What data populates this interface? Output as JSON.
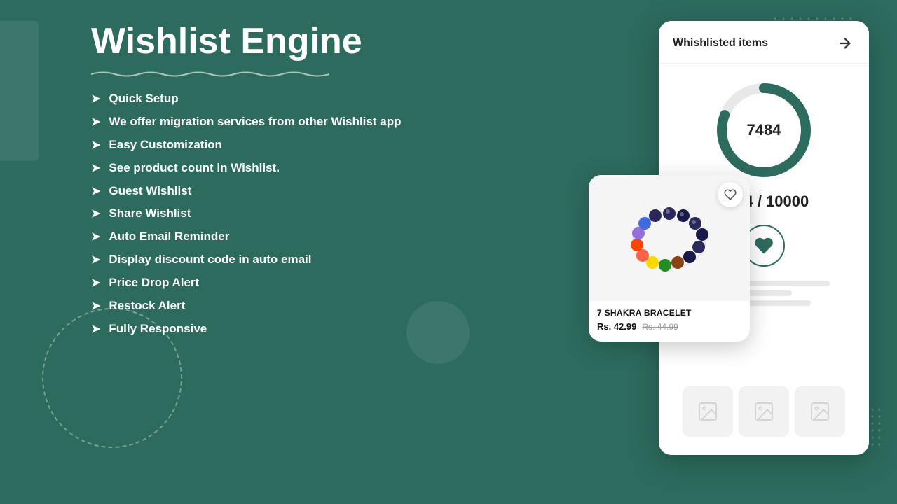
{
  "page": {
    "bg_color": "#2d6b5e"
  },
  "header": {
    "title": "Wishlist Engine"
  },
  "features": {
    "items": [
      {
        "id": "quick-setup",
        "text": "Quick Setup"
      },
      {
        "id": "migration",
        "text": "We offer migration services from other Wishlist app"
      },
      {
        "id": "customization",
        "text": "Easy Customization"
      },
      {
        "id": "product-count",
        "text": "See product count in Wishlist."
      },
      {
        "id": "guest-wishlist",
        "text": "Guest Wishlist"
      },
      {
        "id": "share-wishlist",
        "text": "Share Wishlist"
      },
      {
        "id": "auto-email",
        "text": "Auto Email Reminder"
      },
      {
        "id": "discount-code",
        "text": "Display discount code in auto email"
      },
      {
        "id": "price-drop",
        "text": "Price Drop Alert"
      },
      {
        "id": "restock",
        "text": "Restock Alert"
      },
      {
        "id": "responsive",
        "text": "Fully Responsive"
      }
    ],
    "arrow": "➤"
  },
  "wishlist_card": {
    "title": "Whishlisted items",
    "count": "7484",
    "counter_label": "7484 / 10000",
    "donut": {
      "total": 10000,
      "value": 7484,
      "color_filled": "#2d6b5e",
      "color_empty": "#e8e8e8",
      "circumference": 408
    }
  },
  "product_card": {
    "name": "7 SHAKRA BRACELET",
    "price_current": "Rs. 42.99",
    "price_original": "Rs. 44.99"
  },
  "icons": {
    "arrow_right": "→",
    "heart": "♥",
    "image_placeholder": "🖼"
  }
}
